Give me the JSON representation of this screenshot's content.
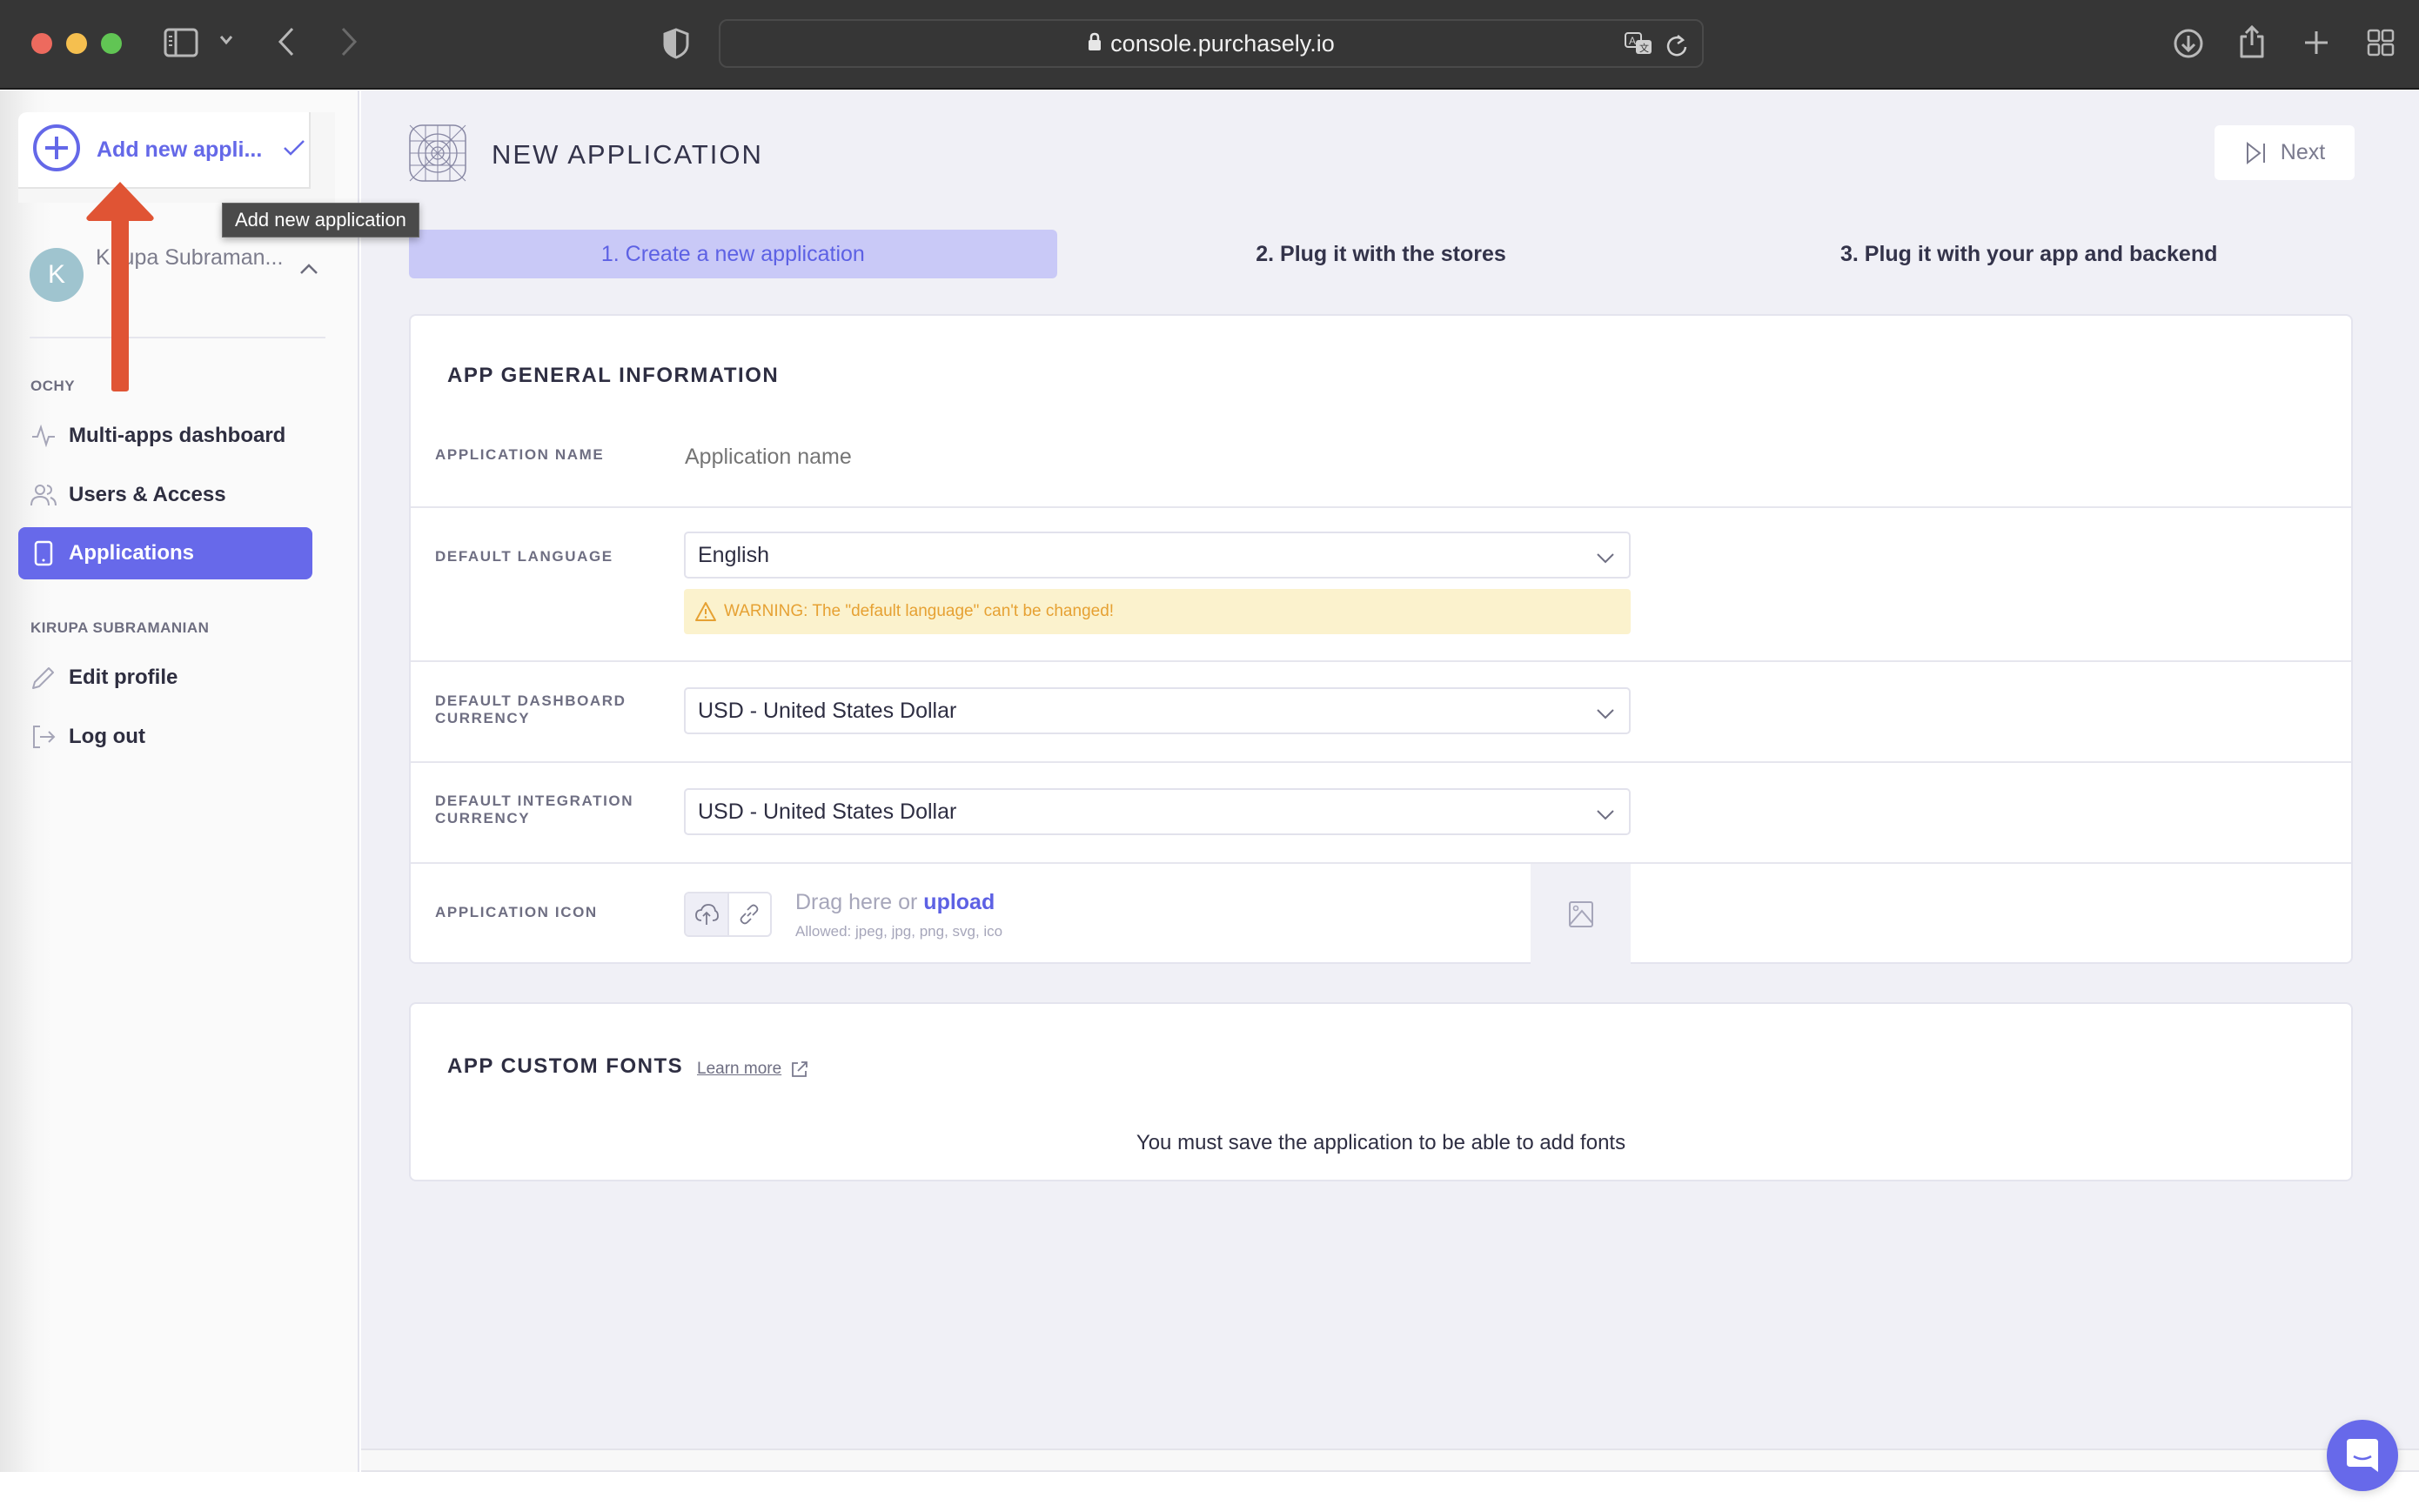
{
  "browser": {
    "url": "console.purchasely.io",
    "icons": [
      "sidebar-toggle-icon",
      "chevron-down-icon",
      "back-icon",
      "forward-icon",
      "shield-icon",
      "lock-icon",
      "translate-icon",
      "reload-icon",
      "download-icon",
      "share-icon",
      "new-tab-icon",
      "tab-overview-icon"
    ]
  },
  "sidebar": {
    "app_switcher": {
      "label": "Add new appli...",
      "tooltip": "Add new application"
    },
    "user": {
      "initial": "K",
      "name": "Kirupa Subraman..."
    },
    "sections": [
      {
        "title": "OCHY",
        "items": [
          {
            "label": "Multi-apps dashboard",
            "icon": "activity-icon",
            "active": false
          },
          {
            "label": "Users & Access",
            "icon": "users-icon",
            "active": false
          },
          {
            "label": "Applications",
            "icon": "mobile-icon",
            "active": true
          }
        ]
      },
      {
        "title": "KIRUPA SUBRAMANIAN",
        "items": [
          {
            "label": "Edit profile",
            "icon": "pencil-icon",
            "active": false
          },
          {
            "label": "Log out",
            "icon": "logout-icon",
            "active": false
          }
        ]
      }
    ]
  },
  "header": {
    "title": "NEW APPLICATION",
    "next_label": "Next"
  },
  "steps": [
    {
      "label": "1. Create a new application",
      "active": true
    },
    {
      "label": "2. Plug it with the stores",
      "active": false
    },
    {
      "label": "3. Plug it with your app and backend",
      "active": false
    }
  ],
  "general": {
    "title": "APP GENERAL INFORMATION",
    "app_name": {
      "label": "APPLICATION NAME",
      "value": "",
      "placeholder": "Application name"
    },
    "default_language": {
      "label": "DEFAULT LANGUAGE",
      "value": "English",
      "warning": "WARNING: The \"default language\" can't be changed!"
    },
    "dashboard_currency": {
      "label": "DEFAULT DASHBOARD CURRENCY",
      "value": "USD - United States Dollar"
    },
    "integration_currency": {
      "label": "DEFAULT INTEGRATION CURRENCY",
      "value": "USD - United States Dollar"
    },
    "app_icon": {
      "label": "APPLICATION ICON",
      "drag_text": "Drag here or ",
      "upload_link": "upload",
      "allowed": "Allowed: jpeg, jpg, png, svg, ico"
    }
  },
  "fonts": {
    "title": "APP CUSTOM FONTS",
    "learn_more": "Learn more",
    "message": "You must save the application to be able to add fonts"
  },
  "colors": {
    "accent": "#6769ea",
    "step_active_bg": "#c9c9f7",
    "warning_bg": "#fbf2cd",
    "warning_text": "#e6a133",
    "annotation_arrow": "#e05434"
  }
}
